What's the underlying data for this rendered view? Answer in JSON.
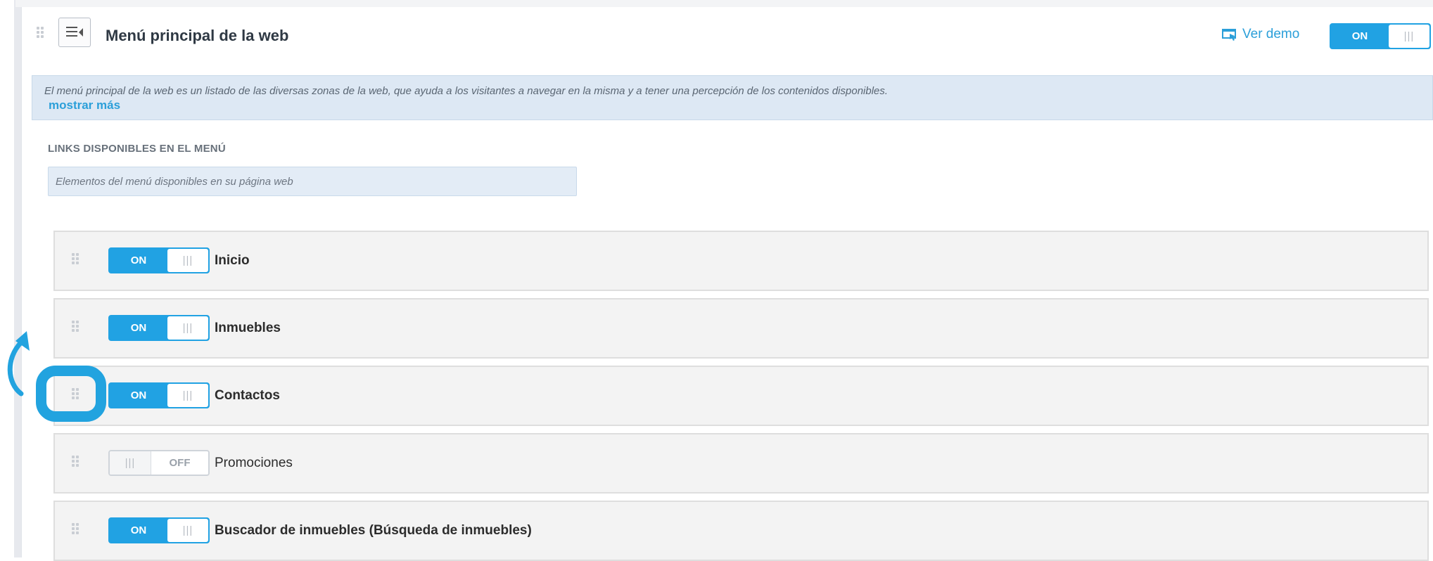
{
  "header": {
    "title": "Menú principal de la web",
    "demo_label": "Ver demo",
    "toggle": {
      "state": "on",
      "on_label": "ON",
      "knob": "|||"
    }
  },
  "info": {
    "description": "El menú principal de la web es un listado de las diversas zonas de la web, que ayuda a los visitantes a navegar en la misma y a tener una percepción de los contenidos disponibles.",
    "show_more": "mostrar más"
  },
  "links_section": {
    "heading": "LINKS DISPONIBLES EN EL MENÚ",
    "filter_placeholder": "Elementos del menú disponibles en su página web"
  },
  "menu_items": [
    {
      "label": "Inicio",
      "enabled": true,
      "on_label": "ON",
      "knob": "|||"
    },
    {
      "label": "Inmuebles",
      "enabled": true,
      "on_label": "ON",
      "knob": "|||"
    },
    {
      "label": "Contactos",
      "enabled": true,
      "on_label": "ON",
      "knob": "|||"
    },
    {
      "label": "Promociones",
      "enabled": false,
      "off_label": "OFF",
      "knob": "|||"
    },
    {
      "label": "Buscador de inmuebles (Búsqueda de inmuebles)",
      "enabled": true,
      "on_label": "ON",
      "knob": "|||"
    }
  ],
  "colors": {
    "accent": "#21a2e3",
    "link": "#2b9fd9",
    "info_bg": "#dde8f4",
    "row_bg": "#f3f3f3",
    "highlight": "#22a3df"
  },
  "icons": [
    "drag-handle-icon",
    "menu-list-icon",
    "demo-preview-icon",
    "curved-arrow-icon"
  ]
}
